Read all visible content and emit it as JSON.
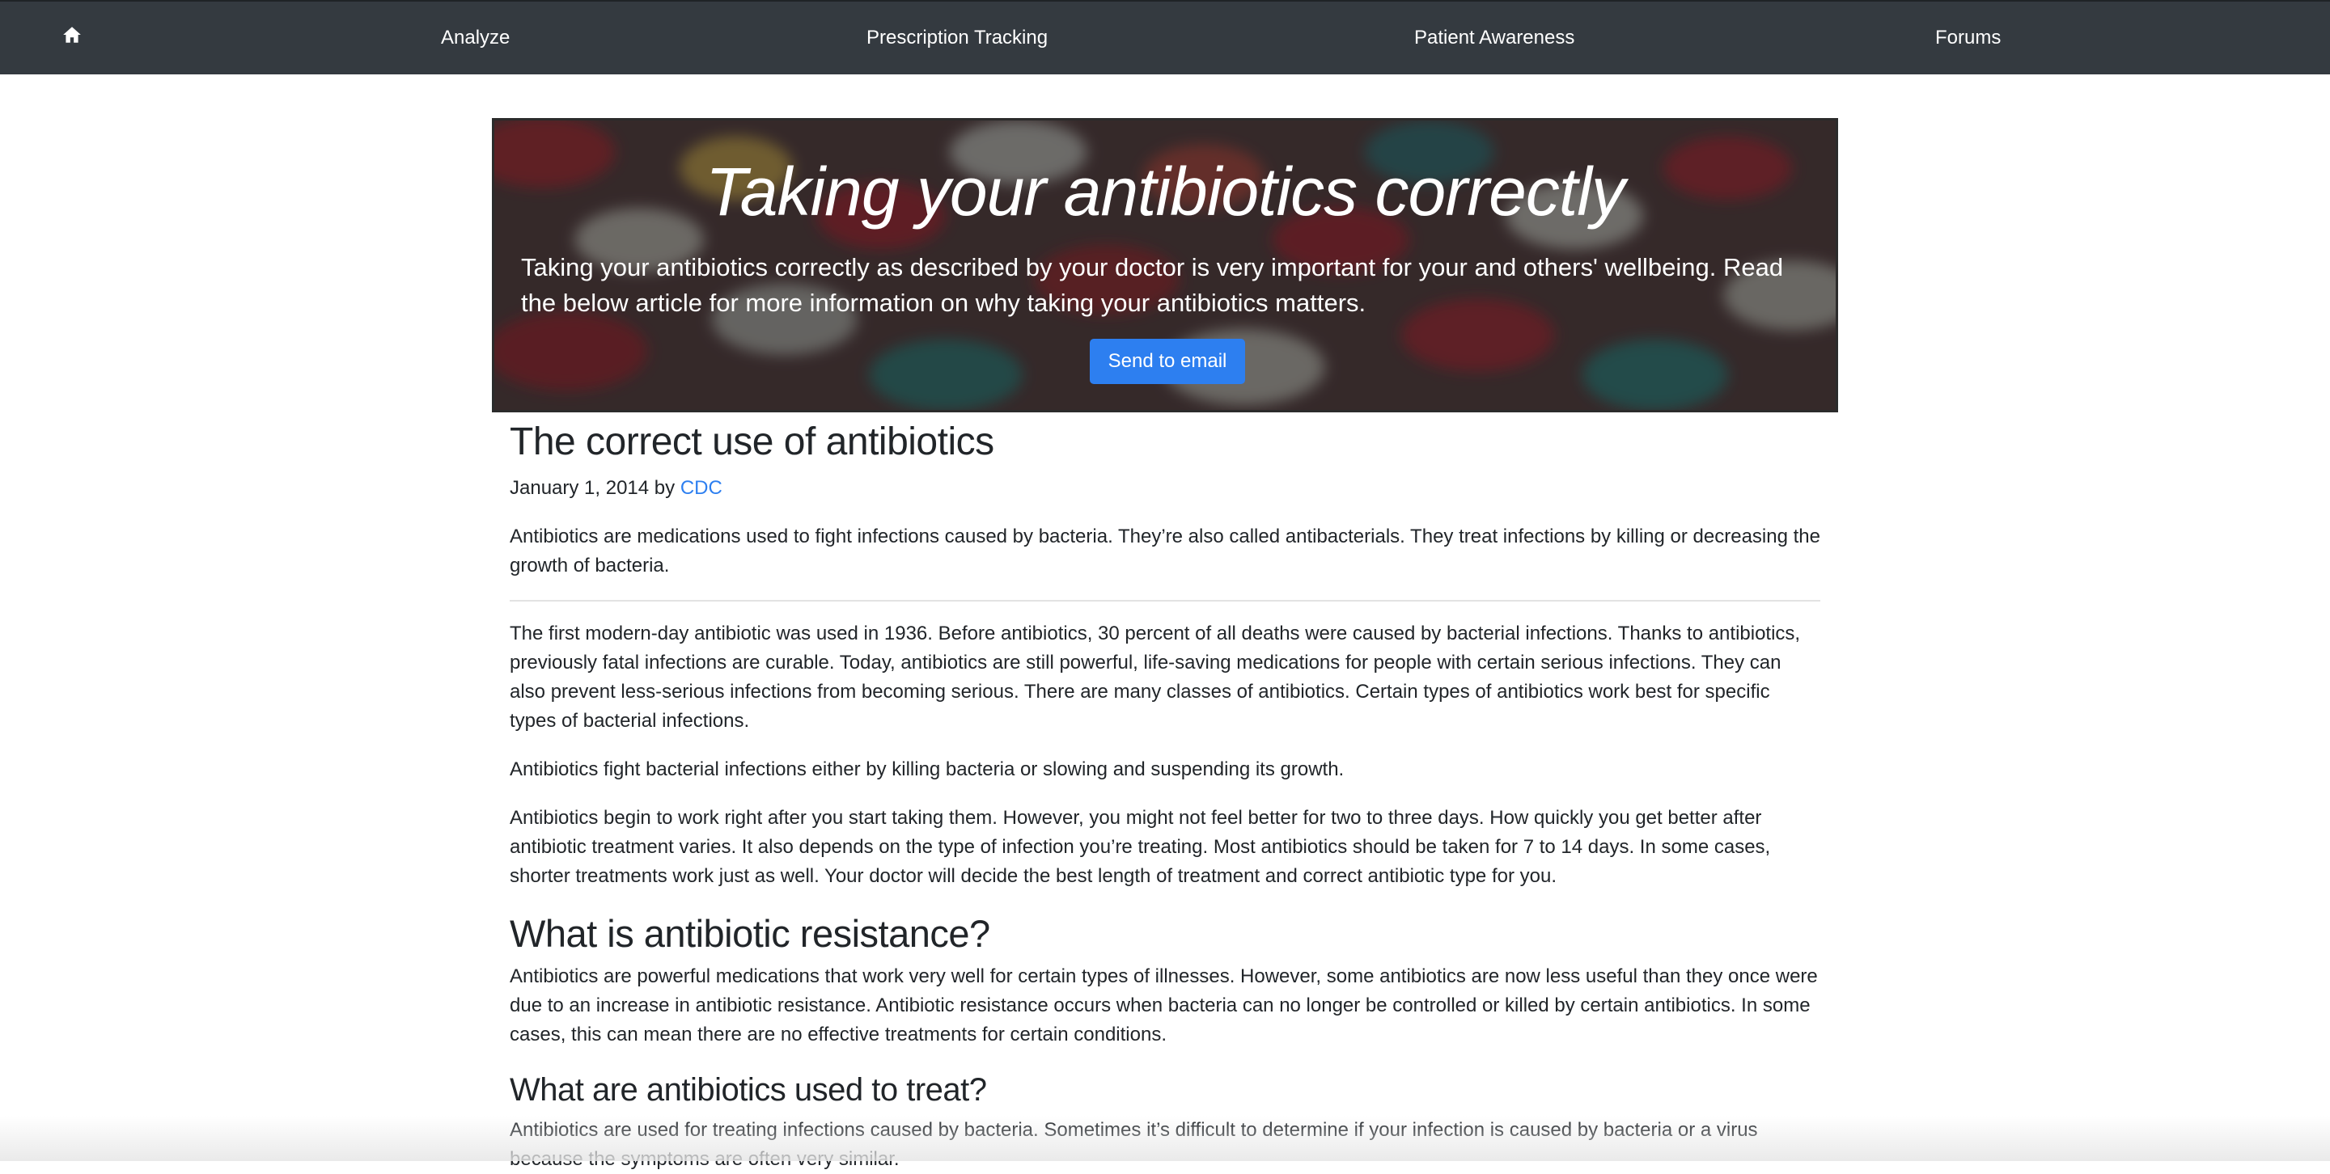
{
  "nav": {
    "home_icon": "home-icon",
    "items": [
      {
        "label": "Analyze"
      },
      {
        "label": "Prescription Tracking"
      },
      {
        "label": "Patient Awareness"
      },
      {
        "label": "Forums"
      }
    ]
  },
  "hero": {
    "title": "Taking your antibiotics correctly",
    "text": "Taking your antibiotics correctly as described by your doctor is very important for your and others' wellbeing. Read the below article for more information on why taking your antibiotics matters.",
    "button_label": "Send to email"
  },
  "article": {
    "title": "The correct use of antibiotics",
    "date": "January 1, 2014",
    "by": "by",
    "author": "CDC",
    "intro": "Antibiotics are medications used to fight infections caused by bacteria. They’re also called antibacterials. They treat infections by killing or decreasing the growth of bacteria.",
    "paragraphs": [
      "The first modern-day antibiotic was used in 1936. Before antibiotics, 30 percent of all deaths were caused by bacterial infections. Thanks to antibiotics, previously fatal infections are curable. Today, antibiotics are still powerful, life-saving medications for people with certain serious infections. They can also prevent less-serious infections from becoming serious. There are many classes of antibiotics. Certain types of antibiotics work best for specific types of bacterial infections.",
      "Antibiotics fight bacterial infections either by killing bacteria or slowing and suspending its growth.",
      "Antibiotics begin to work right after you start taking them. However, you might not feel better for two to three days. How quickly you get better after antibiotic treatment varies. It also depends on the type of infection you’re treating. Most antibiotics should be taken for 7 to 14 days. In some cases, shorter treatments work just as well. Your doctor will decide the best length of treatment and correct antibiotic type for you."
    ],
    "section1_title": "What is antibiotic resistance?",
    "section1_text": "Antibiotics are powerful medications that work very well for certain types of illnesses. However, some antibiotics are now less useful than they once were due to an increase in antibiotic resistance. Antibiotic resistance occurs when bacteria can no longer be controlled or killed by certain antibiotics. In some cases, this can mean there are no effective treatments for certain conditions.",
    "section2_title": "What are antibiotics used to treat?",
    "section2_text": "Antibiotics are used for treating infections caused by bacteria. Sometimes it’s difficult to determine if your infection is caused by bacteria or a virus because the symptoms are often very similar."
  }
}
